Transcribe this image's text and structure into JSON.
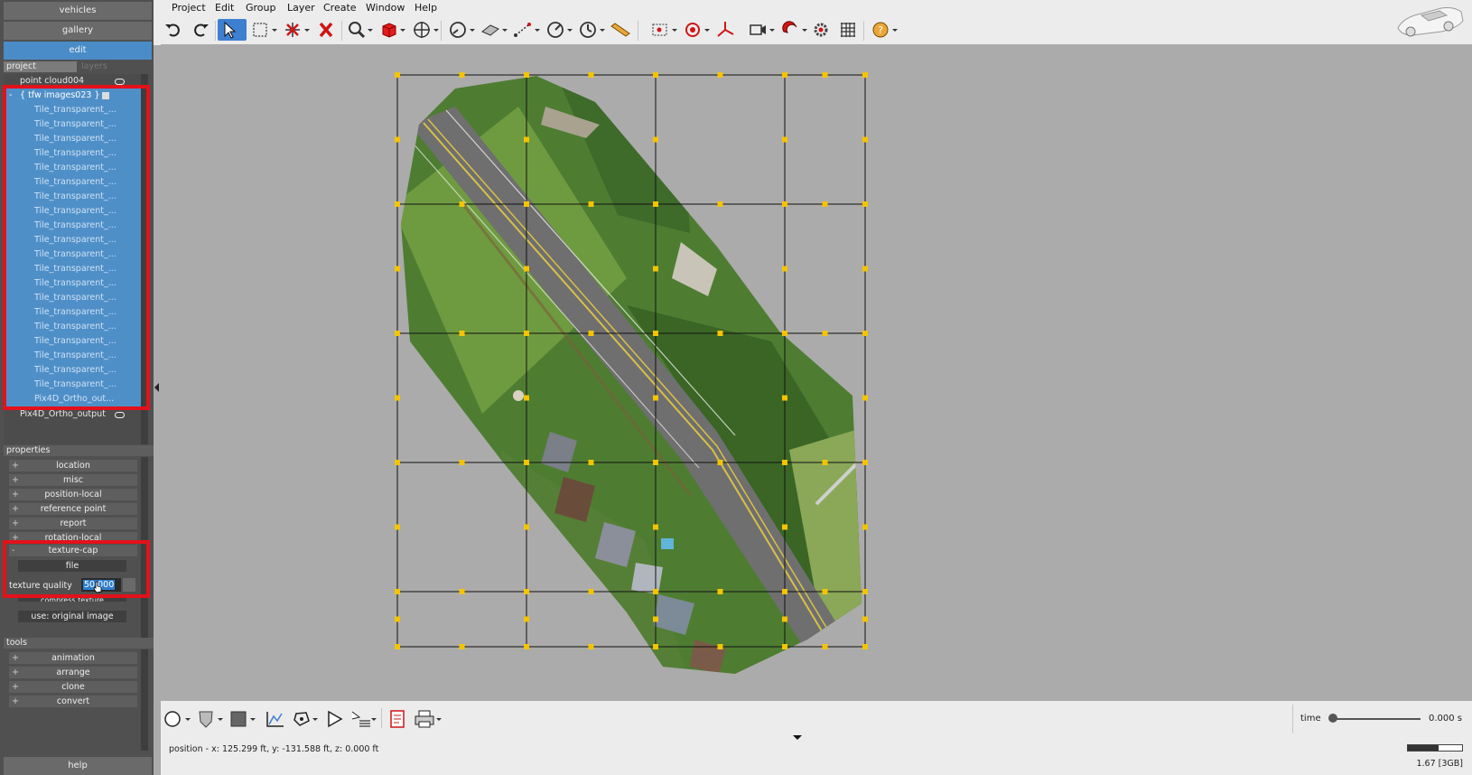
{
  "left_panel": {
    "top_buttons": [
      "vehicles",
      "gallery",
      "edit"
    ],
    "tabs": {
      "project": "project",
      "layers": "layers"
    },
    "tree": {
      "point_cloud": "point cloud004",
      "group": "{ tfw images023 }",
      "tiles": [
        "Tile_transparent_...",
        "Tile_transparent_...",
        "Tile_transparent_...",
        "Tile_transparent_...",
        "Tile_transparent_...",
        "Tile_transparent_...",
        "Tile_transparent_...",
        "Tile_transparent_...",
        "Tile_transparent_...",
        "Tile_transparent_...",
        "Tile_transparent_...",
        "Tile_transparent_...",
        "Tile_transparent_...",
        "Tile_transparent_...",
        "Tile_transparent_...",
        "Tile_transparent_...",
        "Tile_transparent_...",
        "Tile_transparent_...",
        "Tile_transparent_...",
        "Tile_transparent_..."
      ],
      "group_last": "Pix4D_Ortho_out...",
      "ortho_output": "Pix4D_Ortho_output"
    },
    "properties": {
      "header": "properties",
      "items": [
        "location",
        "misc",
        "position-local",
        "reference point",
        "report",
        "rotation-local"
      ],
      "texture_cap": {
        "label": "texture-cap",
        "file_button": "file",
        "quality_label": "texture quality",
        "quality_value": "50.000",
        "hidden_button": "compress texture",
        "original_button": "use: original image"
      }
    },
    "tools": {
      "header": "tools",
      "items": [
        "animation",
        "arrange",
        "clone",
        "convert"
      ]
    },
    "help": "help"
  },
  "menu": [
    "Project",
    "Edit",
    "Group",
    "Layer",
    "Create",
    "Window",
    "Help"
  ],
  "toolbar_icons": [
    "undo-icon",
    "redo-icon",
    "select-arrow-icon",
    "box-select-icon",
    "axis-delete-icon",
    "delete-x-icon",
    "zoom-icon",
    "cube-icon",
    "move-target-icon",
    "measure-dial-icon",
    "plane-icon",
    "line-measure-icon",
    "angle-dial-icon",
    "clock-dial-icon",
    "ruler-icon",
    "frame-icon",
    "target-icon",
    "axes-icon",
    "camera-icon",
    "magnet-icon",
    "settings-icon",
    "grid-icon",
    "help-icon"
  ],
  "bottom_tools": [
    "circle-icon",
    "shield-icon",
    "square-icon",
    "graph-icon",
    "rotate-icon",
    "play-icon",
    "list-icon",
    "report-icon",
    "print-icon"
  ],
  "timeline": {
    "label": "time",
    "value": "0.000 s"
  },
  "status": {
    "position": "position - x: 125.299 ft, y: -131.588 ft, z: 0.000 ft",
    "memory": "1.67 [3GB]",
    "memory_fraction": 0.56
  },
  "colors": {
    "selection": "#4f8fc8",
    "highlight_box": "#e3111a",
    "grid_handle": "#f5c400"
  }
}
